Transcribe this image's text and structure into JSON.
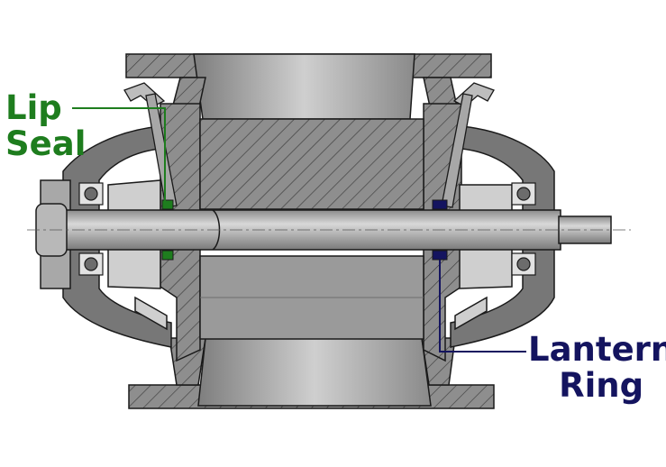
{
  "colors": {
    "lip_seal": "#1e7d1e",
    "lantern_ring": "#14145f",
    "body_dark": "#5e5e5e",
    "body_mid": "#8c8c8c",
    "body_light": "#c2c2c2",
    "shaft": "#a9a9a9",
    "outline": "#1a1a1a"
  },
  "labels": {
    "lip_seal": [
      "Lip",
      "Seal"
    ],
    "lantern_ring": [
      "Lantern",
      "Ring"
    ]
  }
}
